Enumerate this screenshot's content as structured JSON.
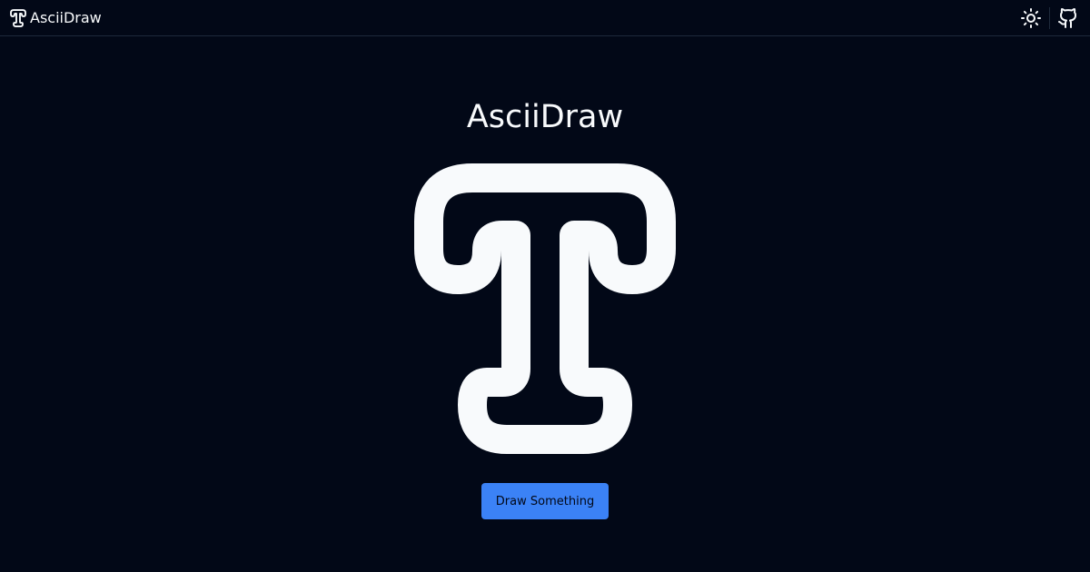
{
  "header": {
    "brand_name": "AsciiDraw",
    "actions": [
      {
        "icon": "sun-icon",
        "purpose": "theme toggle"
      },
      {
        "icon": "github-icon",
        "purpose": "source repository"
      }
    ]
  },
  "main": {
    "title": "AsciiDraw",
    "logo_icon": "text-t-icon",
    "cta_label": "Draw Something"
  },
  "colors": {
    "background": "#020817",
    "foreground": "#f8fafc",
    "border": "#1e293b",
    "accent": "#3b82f6"
  }
}
